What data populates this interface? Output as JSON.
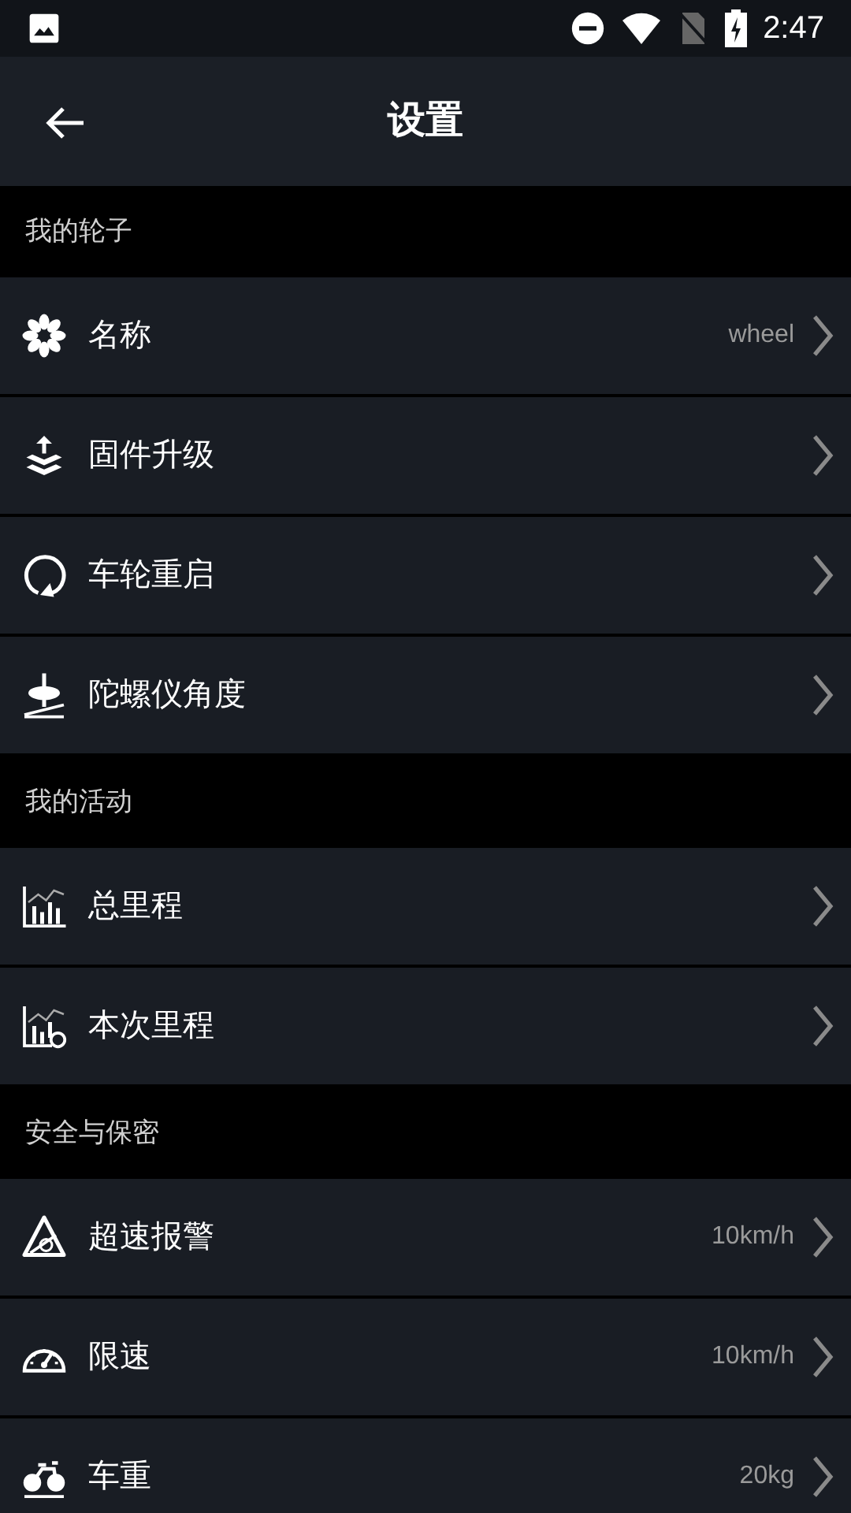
{
  "status_bar": {
    "time": "2:47"
  },
  "header": {
    "title": "设置"
  },
  "sections": [
    {
      "title": "我的轮子",
      "items": [
        {
          "kind": "name",
          "label": "名称",
          "value": "wheel"
        },
        {
          "kind": "firmware",
          "label": "固件升级"
        },
        {
          "kind": "restart",
          "label": "车轮重启"
        },
        {
          "kind": "gyro",
          "label": "陀螺仪角度"
        }
      ]
    },
    {
      "title": "我的活动",
      "items": [
        {
          "kind": "total",
          "label": "总里程"
        },
        {
          "kind": "trip",
          "label": "本次里程"
        }
      ]
    },
    {
      "title": "安全与保密",
      "items": [
        {
          "kind": "alarm",
          "label": "超速报警",
          "value": "10km/h"
        },
        {
          "kind": "limit",
          "label": "限速",
          "value": "10km/h"
        },
        {
          "kind": "weight",
          "label": "车重",
          "value": "20kg"
        }
      ]
    }
  ]
}
